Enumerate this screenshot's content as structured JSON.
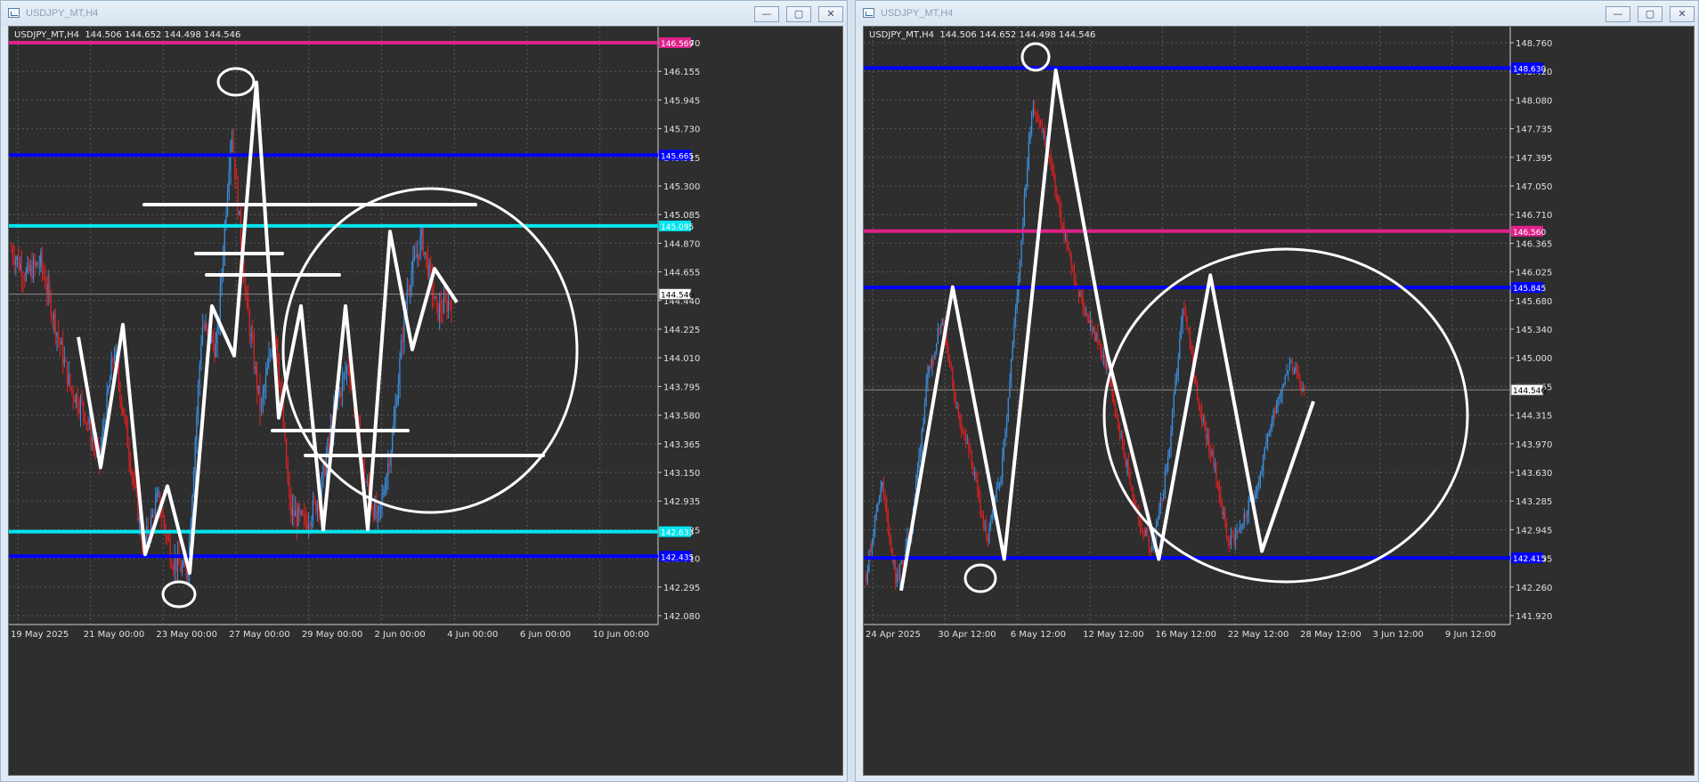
{
  "windows": [
    {
      "title": "USDJPY_MT,H4",
      "info_symbol": "USDJPY_MT,H4",
      "info_ohlc": "144.506 144.652 144.498 144.546",
      "controls": {
        "minimize": "—",
        "maximize": "▢",
        "close": "✕"
      },
      "price_labels": [
        "146.370",
        "146.155",
        "145.945",
        "145.730",
        "145.515",
        "145.300",
        "145.085",
        "144.870",
        "144.655",
        "144.440",
        "144.225",
        "144.010",
        "143.795",
        "143.580",
        "143.365",
        "143.150",
        "142.935",
        "142.725",
        "142.510",
        "142.295",
        "142.080"
      ],
      "time_labels": [
        "19 May 2025",
        "21 May 00:00",
        "23 May 00:00",
        "27 May 00:00",
        "29 May 00:00",
        "2 Jun 00:00",
        "4 Jun 00:00",
        "6 Jun 00:00",
        "10 Jun 00:00"
      ],
      "price_range": [
        142.0,
        146.57
      ],
      "current_price": "144.546",
      "horizontal_lines": [
        {
          "price": 146.57,
          "color": "#e0218a",
          "label": "146.569"
        },
        {
          "price": 145.665,
          "color": "#0000ff",
          "label": "145.665"
        },
        {
          "price": 145.095,
          "color": "#00e5ee",
          "label": "145.095"
        },
        {
          "price": 142.633,
          "color": "#00e5ee",
          "label": "142.633"
        },
        {
          "price": 142.435,
          "color": "#0000ff",
          "label": "142.435"
        }
      ],
      "trace_prices": [
        144.2,
        143.15,
        144.3,
        142.45,
        143.0,
        142.3,
        144.45,
        144.05,
        146.25,
        143.55,
        144.45,
        142.65,
        144.45,
        142.65,
        145.05,
        144.1,
        144.75,
        144.48
      ],
      "candle_path": [
        144.9,
        144.7,
        144.8,
        144.3,
        143.8,
        143.6,
        143.2,
        144.1,
        143.3,
        142.5,
        142.9,
        142.4,
        142.3,
        144.3,
        144.1,
        145.9,
        144.5,
        143.6,
        144.3,
        142.8,
        142.7,
        142.9,
        143.6,
        144.0,
        143.1,
        142.7,
        143.4,
        144.6,
        145.0,
        144.4,
        144.5
      ]
    },
    {
      "title": "USDJPY_MT,H4",
      "info_symbol": "USDJPY_MT,H4",
      "info_ohlc": "144.506 144.652 144.498 144.546",
      "controls": {
        "minimize": "—",
        "maximize": "▢",
        "close": "✕"
      },
      "price_labels": [
        "148.760",
        "148.420",
        "148.080",
        "147.735",
        "147.395",
        "147.050",
        "146.710",
        "146.365",
        "146.025",
        "145.680",
        "145.340",
        "145.000",
        "144.655",
        "144.315",
        "143.970",
        "143.630",
        "143.285",
        "142.945",
        "142.605",
        "142.260",
        "141.920"
      ],
      "time_labels": [
        "24 Apr 2025",
        "30 Apr 12:00",
        "6 May 12:00",
        "12 May 12:00",
        "16 May 12:00",
        "22 May 12:00",
        "28 May 12:00",
        "3 Jun 12:00",
        "9 Jun 12:00"
      ],
      "price_range": [
        141.75,
        148.95
      ],
      "current_price": "144.546",
      "horizontal_lines": [
        {
          "price": 148.63,
          "color": "#0000ff",
          "label": "148.630"
        },
        {
          "price": 146.56,
          "color": "#e0218a",
          "label": "146.560"
        },
        {
          "price": 145.845,
          "color": "#0000ff",
          "label": "145.845"
        },
        {
          "price": 142.415,
          "color": "#0000ff",
          "label": "142.415"
        }
      ],
      "trace_prices": [
        142.0,
        145.85,
        142.4,
        148.6,
        145.0,
        142.4,
        146.0,
        142.5,
        144.4
      ],
      "candle_path": [
        142.2,
        143.4,
        142.1,
        142.8,
        144.6,
        145.5,
        144.3,
        143.6,
        142.6,
        143.6,
        145.8,
        148.2,
        147.6,
        146.6,
        145.8,
        145.3,
        144.8,
        143.8,
        142.9,
        142.5,
        143.7,
        145.6,
        144.4,
        143.6,
        142.6,
        142.9,
        143.4,
        144.3,
        144.9,
        144.5
      ]
    }
  ],
  "colors": {
    "chart_bg": "#2e2e2e",
    "grid": "#5a5a5a",
    "bull": "#3a8fe0",
    "bear": "#e02020",
    "annotation": "#ffffff"
  }
}
